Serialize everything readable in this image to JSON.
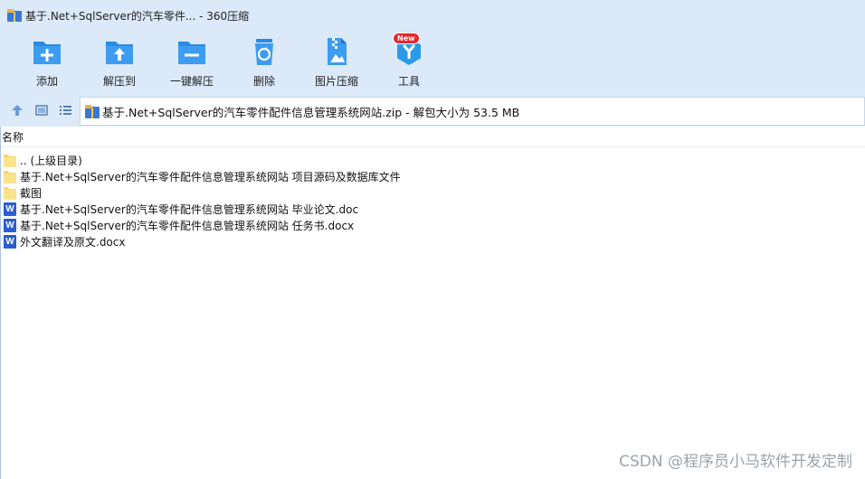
{
  "window": {
    "title": "基于.Net+SqlServer的汽车零件... - 360压缩"
  },
  "toolbar": {
    "items": [
      {
        "label": "添加",
        "icon": "add-folder-icon"
      },
      {
        "label": "解压到",
        "icon": "extract-to-icon"
      },
      {
        "label": "一键解压",
        "icon": "one-click-extract-icon"
      },
      {
        "label": "删除",
        "icon": "delete-recycle-icon"
      },
      {
        "label": "图片压缩",
        "icon": "image-compress-icon"
      },
      {
        "label": "工具",
        "icon": "tools-icon",
        "badge": "New"
      }
    ]
  },
  "address": {
    "text": "基于.Net+SqlServer的汽车零件配件信息管理系统网站.zip - 解包大小为 53.5 MB"
  },
  "list": {
    "column_name": "名称",
    "items": [
      {
        "name": ".. (上级目录)",
        "type": "folder"
      },
      {
        "name": "基于.Net+SqlServer的汽车零件配件信息管理系统网站 项目源码及数据库文件",
        "type": "folder"
      },
      {
        "name": "截图",
        "type": "folder"
      },
      {
        "name": "基于.Net+SqlServer的汽车零件配件信息管理系统网站 毕业论文.doc",
        "type": "word"
      },
      {
        "name": "基于.Net+SqlServer的汽车零件配件信息管理系统网站 任务书.docx",
        "type": "word"
      },
      {
        "name": "外文翻译及原文.docx",
        "type": "word"
      }
    ]
  },
  "watermark": "CSDN @程序员小马软件开发定制",
  "colors": {
    "toolbar_bg": "#dbe9f9",
    "icon_blue": "#2a8be0",
    "folder_yellow": "#f7d86a",
    "word_blue": "#2b5dd1"
  }
}
